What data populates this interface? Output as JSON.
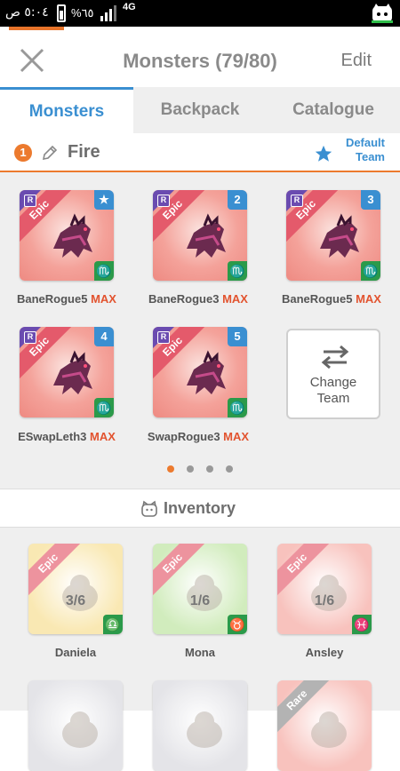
{
  "statusbar": {
    "time": "٥:٠٤ ص",
    "battery": "%٦٥",
    "network": "4G"
  },
  "header": {
    "title": "Monsters (79/80)",
    "edit_label": "Edit"
  },
  "tabs": [
    {
      "label": "Monsters"
    },
    {
      "label": "Backpack"
    },
    {
      "label": "Catalogue"
    }
  ],
  "team": {
    "number": "1",
    "name": "Fire",
    "default_label_1": "Default",
    "default_label_2": "Team"
  },
  "team_monsters": [
    {
      "name": "BaneRogue5",
      "max": "MAX",
      "rarity": "Epic",
      "badge": "R",
      "slot": "★",
      "zodiac": "♏"
    },
    {
      "name": "BaneRogue3",
      "max": "MAX",
      "rarity": "Epic",
      "badge": "R",
      "slot": "2",
      "zodiac": "♏"
    },
    {
      "name": "BaneRogue5",
      "max": "MAX",
      "rarity": "Epic",
      "badge": "R",
      "slot": "3",
      "zodiac": "♏"
    },
    {
      "name": "ESwapLeth3",
      "max": "MAX",
      "rarity": "Epic",
      "badge": "R",
      "slot": "4",
      "zodiac": "♏"
    },
    {
      "name": "SwapRogue3",
      "max": "MAX",
      "rarity": "Epic",
      "badge": "R",
      "slot": "5",
      "zodiac": "♏"
    }
  ],
  "change_team": {
    "line1": "Change",
    "line2": "Team"
  },
  "pagination": {
    "pages": 4,
    "current": 1
  },
  "inventory": {
    "title": "Inventory",
    "items": [
      {
        "name": "Daniela",
        "count": "3/6",
        "rarity": "Epic",
        "zodiac": "♎",
        "color": "#f6dc8a"
      },
      {
        "name": "Mona",
        "count": "1/6",
        "rarity": "Epic",
        "zodiac": "♉",
        "color": "#b9e29a"
      },
      {
        "name": "Ansley",
        "count": "1/6",
        "rarity": "Epic",
        "zodiac": "♓",
        "color": "#f4a29a"
      },
      {
        "name": "",
        "count": "",
        "rarity": "",
        "zodiac": "",
        "color": "#d6d6dc"
      },
      {
        "name": "",
        "count": "",
        "rarity": "",
        "zodiac": "",
        "color": "#d6d6dc"
      },
      {
        "name": "",
        "count": "",
        "rarity": "Rare",
        "zodiac": "",
        "color": "#f4a29a"
      }
    ]
  },
  "colors": {
    "accent": "#3a8fd1",
    "orange": "#ec7a2e",
    "max_red": "#e2532f",
    "epic_ribbon": "#e45a6b"
  }
}
